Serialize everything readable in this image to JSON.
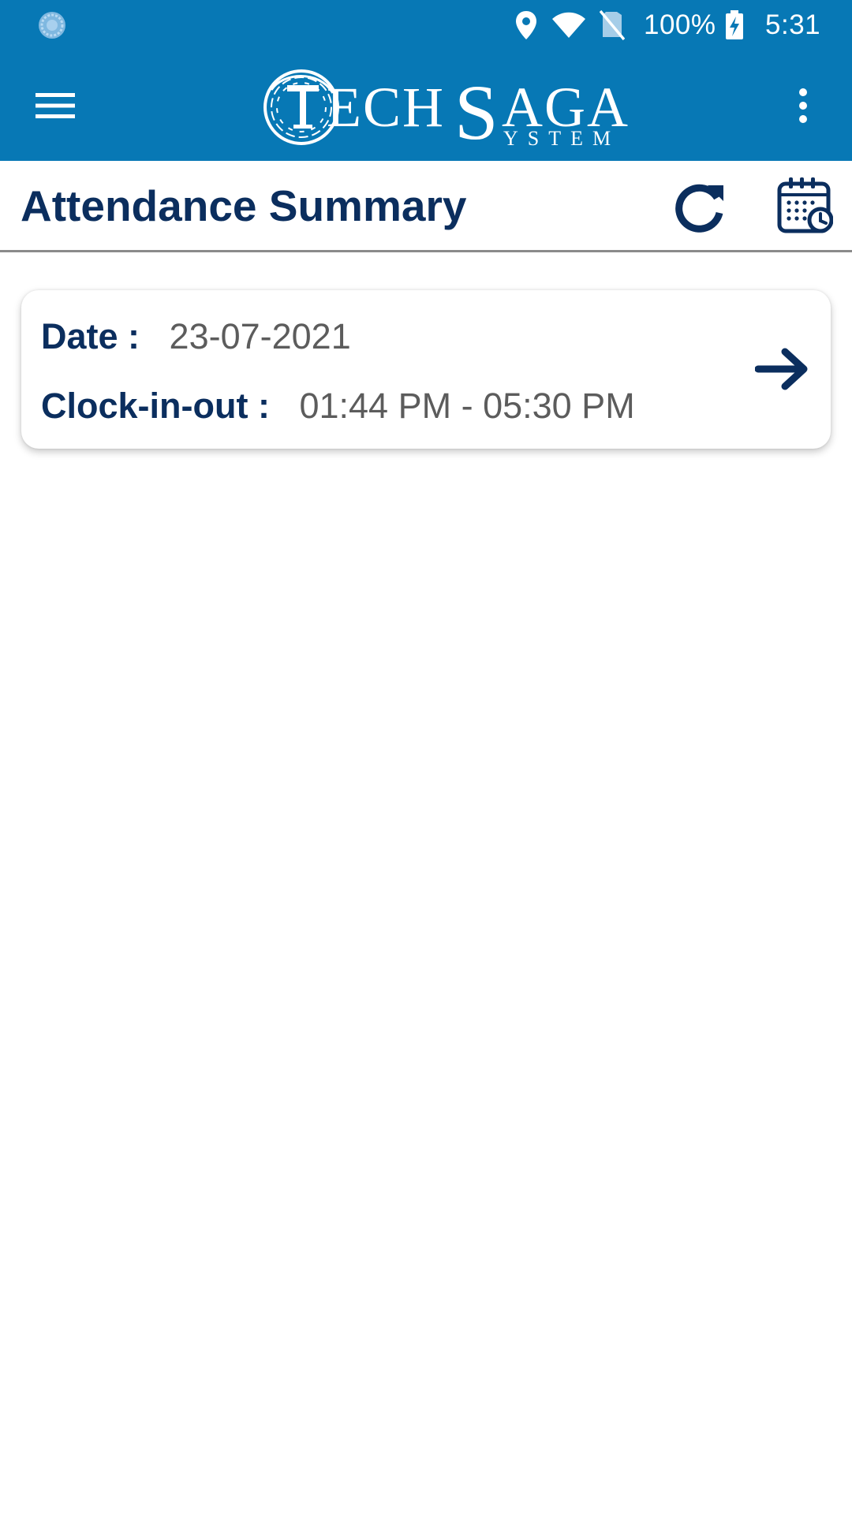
{
  "status_bar": {
    "battery_percent": "100%",
    "time": "5:31",
    "icons": [
      "app-notification-icon",
      "location-icon",
      "wifi-icon",
      "no-sim-icon",
      "battery-charging-icon"
    ]
  },
  "app_bar": {
    "menu_icon": "hamburger-menu-icon",
    "logo_text": "TECHSAGA SYSTEM",
    "overflow_icon": "more-vertical-icon",
    "background_color": "#0778b5"
  },
  "page": {
    "title": "Attendance Summary",
    "refresh_icon": "refresh-icon",
    "calendar_icon": "calendar-clock-icon",
    "title_color": "#0b2e5e"
  },
  "attendance": {
    "items": [
      {
        "date_label": "Date :",
        "date_value": "23-07-2021",
        "clock_label": "Clock-in-out :",
        "clock_value": "01:44 PM - 05:30 PM",
        "action_icon": "arrow-right-icon"
      }
    ]
  }
}
